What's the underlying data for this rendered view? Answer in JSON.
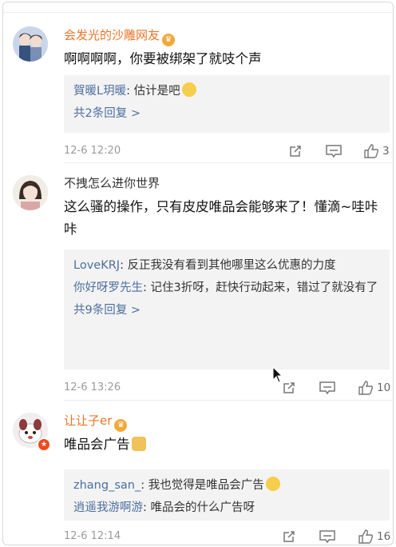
{
  "comments": [
    {
      "username": "会发光的沙雕网友",
      "username_color": "orange",
      "has_badge": true,
      "text": "啊啊啊啊，你要被绑架了就吱个声",
      "replies": [
        {
          "user": "賀暖L玥暖",
          "text": "估计是吧"
        }
      ],
      "more_replies": "共2条回复 >",
      "time": "12-6 12:20",
      "likes": "3"
    },
    {
      "username": "不拽怎么进你世界",
      "username_color": "gray",
      "has_badge": false,
      "text": "这么骚的操作，只有皮皮唯品会能够来了！懂滴~哇咔咔",
      "replies": [
        {
          "user": "LoveKRJ",
          "text": "反正我没有看到其他哪里这么优惠的力度"
        },
        {
          "user": "你好呀罗先生",
          "text": "记住3折呀，赶快行动起来，错过了就没有了"
        }
      ],
      "more_replies": "共9条回复 >",
      "time": "12-6 13:26",
      "likes": "10"
    },
    {
      "username": "让让子er",
      "username_color": "orange",
      "has_badge": true,
      "text": "唯品会广告",
      "replies": [
        {
          "user": "zhang_san_",
          "text": "我也觉得是唯品会广告"
        },
        {
          "user": "逍遥我游啊游",
          "text": "唯品会的什么广告呀"
        }
      ],
      "time": "12-6 12:14",
      "likes": "16"
    }
  ],
  "icons": {
    "badge": "crown-badge-icon",
    "share": "share-icon",
    "reply": "comment-icon",
    "like": "thumbs-up-icon",
    "vip": "vip-star-icon"
  },
  "colors": {
    "username_orange": "#e8762b",
    "link_blue": "#4b6f9f",
    "reply_bg": "#f3f3f3",
    "meta_gray": "#9a9a9a"
  }
}
